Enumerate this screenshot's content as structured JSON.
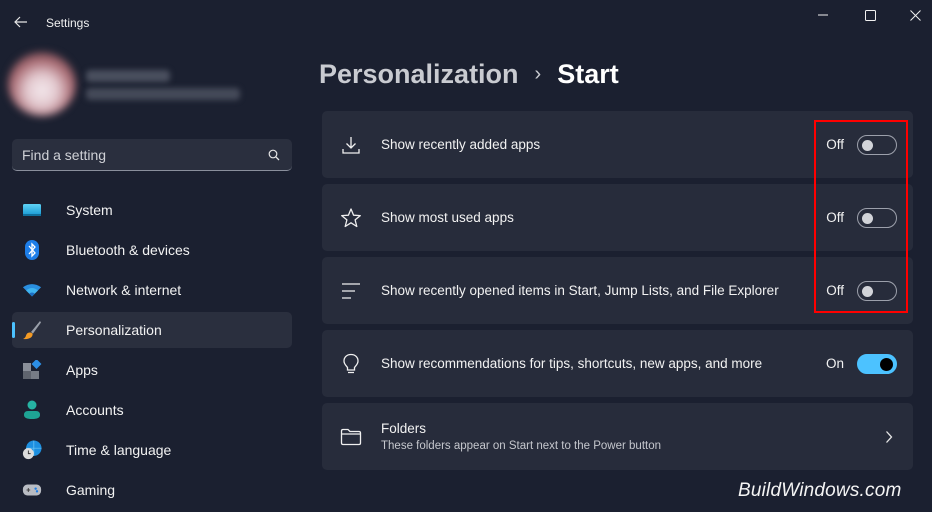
{
  "window": {
    "title": "Settings",
    "controls": {
      "minimize": "minimize-icon",
      "maximize": "maximize-icon",
      "close": "close-icon"
    }
  },
  "profile": {
    "name": "",
    "email": "",
    "blurred": true
  },
  "search": {
    "placeholder": "Find a setting",
    "value": ""
  },
  "sidebar": {
    "items": [
      {
        "label": "System",
        "icon": "monitor-icon",
        "active": false
      },
      {
        "label": "Bluetooth & devices",
        "icon": "bluetooth-icon",
        "active": false
      },
      {
        "label": "Network & internet",
        "icon": "wifi-icon",
        "active": false
      },
      {
        "label": "Personalization",
        "icon": "paintbrush-icon",
        "active": true
      },
      {
        "label": "Apps",
        "icon": "apps-icon",
        "active": false
      },
      {
        "label": "Accounts",
        "icon": "person-icon",
        "active": false
      },
      {
        "label": "Time & language",
        "icon": "globe-clock-icon",
        "active": false
      },
      {
        "label": "Gaming",
        "icon": "gamepad-icon",
        "active": false
      }
    ]
  },
  "header": {
    "parent": "Personalization",
    "separator": "›",
    "current": "Start"
  },
  "settings": [
    {
      "label": "Show recently added apps",
      "icon": "download-icon",
      "state": "Off",
      "on": false
    },
    {
      "label": "Show most used apps",
      "icon": "star-icon",
      "state": "Off",
      "on": false
    },
    {
      "label": "Show recently opened items in Start, Jump Lists, and File Explorer",
      "icon": "list-icon",
      "state": "Off",
      "on": false
    },
    {
      "label": "Show recommendations for tips, shortcuts, new apps, and more",
      "icon": "lightbulb-icon",
      "state": "On",
      "on": true
    },
    {
      "label": "Folders",
      "sublabel": "These folders appear on Start next to the Power button",
      "icon": "folder-icon"
    }
  ],
  "colors": {
    "accent": "#4cc2ff",
    "background": "#1b2030",
    "card": "#272c3b",
    "highlight": "#ff0000"
  },
  "watermark": "BuildWindows.com"
}
